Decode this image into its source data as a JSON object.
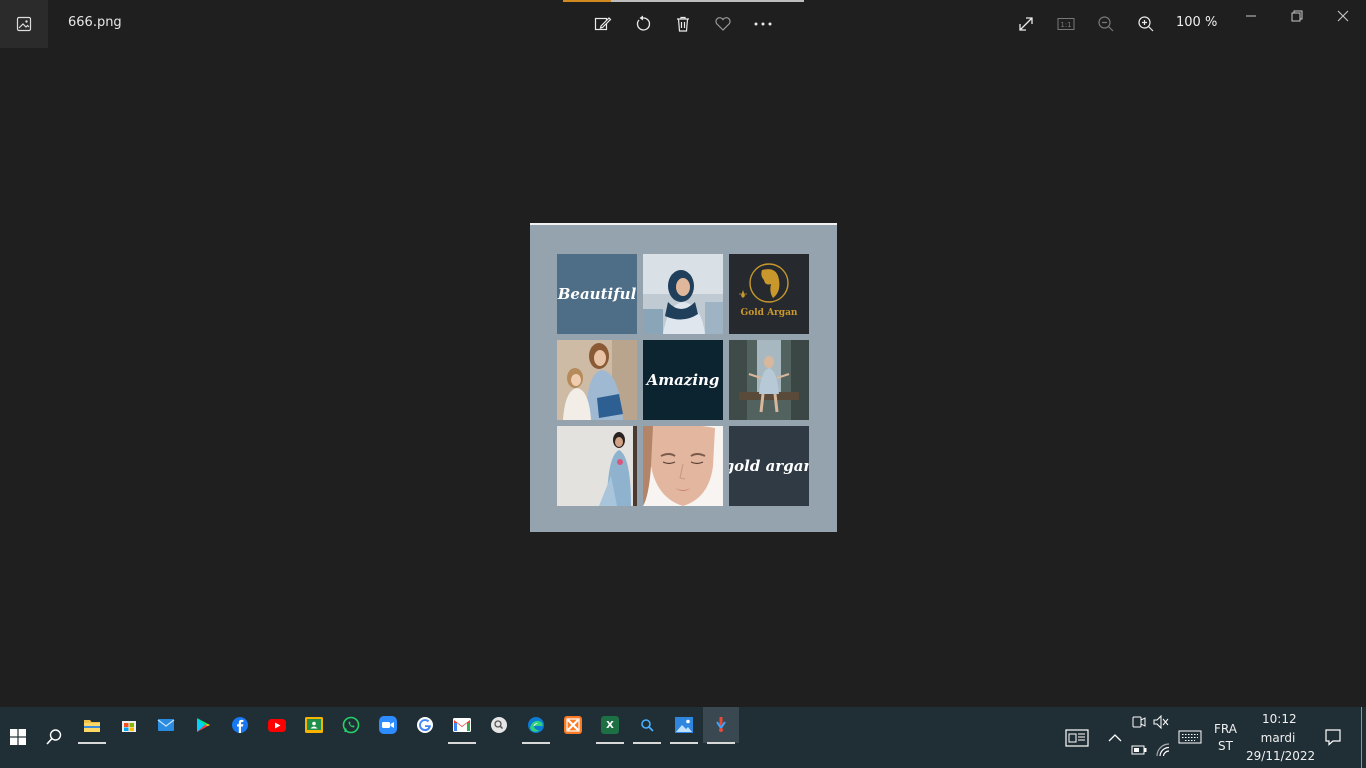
{
  "window": {
    "filename": "666.png",
    "zoom": "100 %"
  },
  "toolbar": {
    "edit": "edit-image-icon",
    "rotate": "rotate-icon",
    "delete": "delete-icon",
    "favorite": "heart-icon",
    "more": "more-icon",
    "fullscreen": "expand-icon",
    "actual_size": "1:1",
    "zoom_out": "zoom-out-icon",
    "zoom_in": "zoom-in-icon"
  },
  "image": {
    "tiles": {
      "t1": "Beautiful",
      "t3_logo": "Gold Argan",
      "t5": "Amazing",
      "t9": "gold argan"
    }
  },
  "taskbar": {
    "apps": [
      "File Explorer",
      "Microsoft Store",
      "Mail",
      "Google Play",
      "Facebook",
      "YouTube",
      "Google Classroom",
      "WhatsApp",
      "Zoom",
      "Google",
      "Gmail",
      "Search app",
      "Microsoft Edge",
      "XAMPP",
      "Excel",
      "Search",
      "Photos",
      "Recorder"
    ],
    "language_line1": "FRA",
    "language_line2": "ST",
    "time": "10:12",
    "day": "mardi",
    "date": "29/11/2022"
  },
  "colors": {
    "background": "#1f1f1f",
    "taskbar": "#202e36",
    "accent_gold": "#c9982c"
  }
}
